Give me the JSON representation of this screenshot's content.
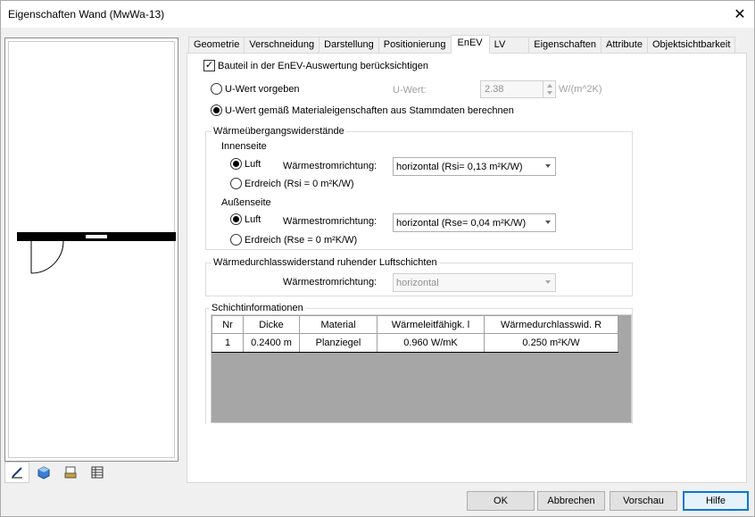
{
  "window": {
    "title": "Eigenschaften Wand (MwWa-13)"
  },
  "tabs": [
    {
      "label": "Geometrie"
    },
    {
      "label": "Verschneidung"
    },
    {
      "label": "Darstellung"
    },
    {
      "label": "Positionierung"
    },
    {
      "label": "EnEV",
      "active": true
    },
    {
      "label": "LV"
    },
    {
      "label": "Eigenschaften"
    },
    {
      "label": "Attribute"
    },
    {
      "label": "Objektsichtbarkeit"
    }
  ],
  "enev": {
    "include_checkbox": {
      "label": "Bauteil in der EnEV-Auswertung berücksichtigen",
      "checked": true
    },
    "uvalue_given": {
      "label": "U-Wert vorgeben",
      "checked": false
    },
    "uvalue_field_label": "U-Wert:",
    "uvalue_value": "2.38",
    "uvalue_unit": "W/(m^2K)",
    "uvalue_calc": {
      "label": "U-Wert gemäß Materialeigenschaften aus Stammdaten berechnen",
      "checked": true
    }
  },
  "heat_transfer": {
    "group_label": "Wärmeübergangswiderstände",
    "inside": {
      "label": "Innenseite",
      "air_label": "Luft",
      "direction_label": "Wärmestromrichtung:",
      "direction_value": "horizontal (Rsi= 0,13 m²K/W)",
      "soil_label": "Erdreich (Rsi = 0 m²K/W)"
    },
    "outside": {
      "label": "Außenseite",
      "air_label": "Luft",
      "direction_label": "Wärmestromrichtung:",
      "direction_value": "horizontal (Rse= 0,04 m²K/W)",
      "soil_label": "Erdreich (Rse = 0 m²K/W)"
    }
  },
  "air_layers": {
    "group_label": "Wärmedurchlasswiderstand ruhender Luftschichten",
    "direction_label": "Wärmestromrichtung:",
    "direction_value": "horizontal"
  },
  "layers": {
    "group_label": "Schichtinformationen",
    "columns": [
      "Nr",
      "Dicke",
      "Material",
      "Wärmeleitfähigk. l",
      "Wärmedurchlasswid. R"
    ],
    "rows": [
      [
        "1",
        "0.2400 m",
        "Planziegel",
        "0.960 W/mK",
        "0.250 m²K/W"
      ]
    ]
  },
  "buttons": {
    "ok": "OK",
    "cancel": "Abbrechen",
    "preview": "Vorschau",
    "help": "Hilfe"
  },
  "colors": {
    "accent": "#0078d7",
    "grid_bg": "#a6a6a6"
  }
}
